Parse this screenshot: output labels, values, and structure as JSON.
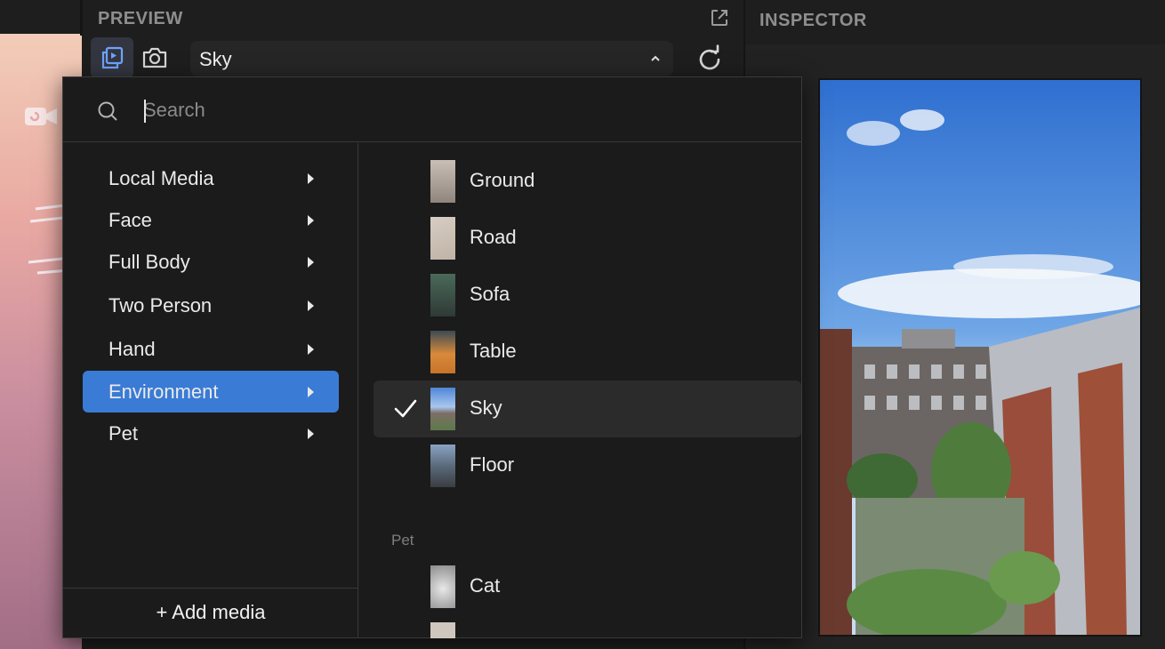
{
  "header": {
    "preview_title": "PREVIEW",
    "inspector_title": "INSPECTOR"
  },
  "toolbar": {
    "selected_media": "Sky",
    "icons": [
      "preview-mode-icon",
      "camera-icon",
      "chevron-up-icon",
      "refresh-icon",
      "external-link-icon"
    ]
  },
  "search": {
    "placeholder": "Search",
    "value": ""
  },
  "categories": [
    {
      "label": "Local Media"
    },
    {
      "label": "Face"
    },
    {
      "label": "Full Body"
    },
    {
      "label": "Two Person"
    },
    {
      "label": "Hand"
    },
    {
      "label": "Environment",
      "selected": true
    },
    {
      "label": "Pet"
    }
  ],
  "media": {
    "environment": [
      {
        "label": "Ground"
      },
      {
        "label": "Road"
      },
      {
        "label": "Sofa"
      },
      {
        "label": "Table"
      },
      {
        "label": "Sky",
        "selected": true
      },
      {
        "label": "Floor"
      }
    ],
    "pet_section_label": "Pet",
    "pet": [
      {
        "label": "Cat"
      },
      {
        "label": ""
      }
    ]
  },
  "footer": {
    "add_media": "+ Add media"
  },
  "colors": {
    "accent": "#3a7bd5",
    "panel_bg": "#1b1b1b",
    "text": "#eaeaea"
  }
}
